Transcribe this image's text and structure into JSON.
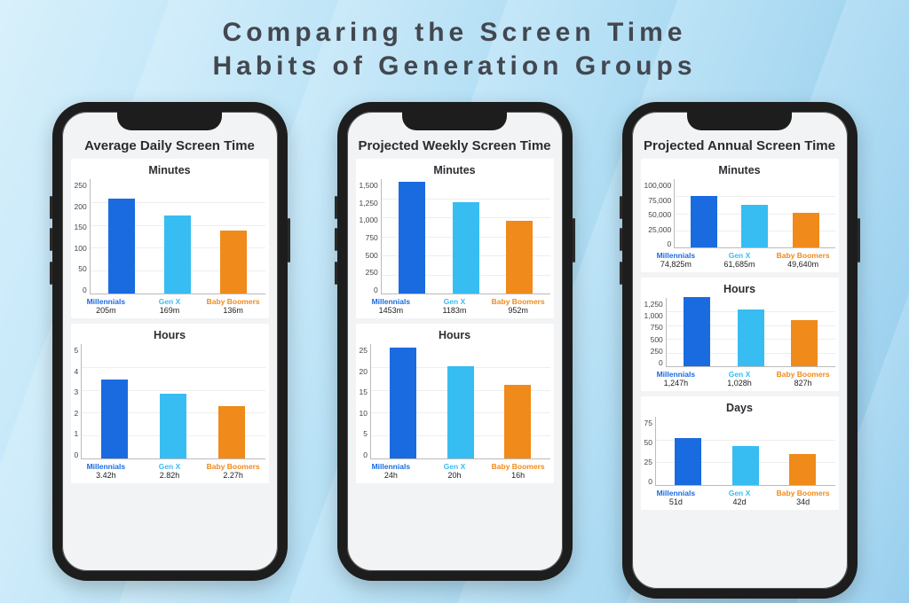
{
  "title_line1": "Comparing the Screen Time",
  "title_line2": "Habits of Generation Groups",
  "categories": [
    "Millennials",
    "Gen X",
    "Baby Boomers"
  ],
  "colors": [
    "#1a6be0",
    "#37bdf2",
    "#f08a1a"
  ],
  "phones": [
    {
      "title": "Average Daily Screen Time",
      "charts": [
        {
          "title": "Minutes",
          "unit": "m",
          "ymax": 250,
          "ticks": [
            "250",
            "200",
            "150",
            "100",
            "50",
            "0"
          ],
          "values": [
            205,
            169,
            136
          ],
          "labels": [
            "205m",
            "169m",
            "136m"
          ]
        },
        {
          "title": "Hours",
          "unit": "h",
          "ymax": 5,
          "ticks": [
            "5",
            "4",
            "3",
            "2",
            "1",
            "0"
          ],
          "values": [
            3.42,
            2.82,
            2.27
          ],
          "labels": [
            "3.42h",
            "2.82h",
            "2.27h"
          ]
        }
      ]
    },
    {
      "title": "Projected Weekly Screen Time",
      "charts": [
        {
          "title": "Minutes",
          "unit": "m",
          "ymax": 1500,
          "ticks": [
            "1,500",
            "1,250",
            "1,000",
            "750",
            "500",
            "250",
            "0"
          ],
          "values": [
            1453,
            1183,
            952
          ],
          "labels": [
            "1453m",
            "1183m",
            "952m"
          ]
        },
        {
          "title": "Hours",
          "unit": "h",
          "ymax": 25,
          "ticks": [
            "25",
            "20",
            "15",
            "10",
            "5",
            "0"
          ],
          "values": [
            24,
            20,
            16
          ],
          "labels": [
            "24h",
            "20h",
            "16h"
          ]
        }
      ]
    },
    {
      "title": "Projected Annual Screen Time",
      "tall": true,
      "charts": [
        {
          "title": "Minutes",
          "unit": "m",
          "ymax": 100000,
          "ticks": [
            "100,000",
            "75,000",
            "50,000",
            "25,000",
            "0"
          ],
          "values": [
            74825,
            61685,
            49640
          ],
          "labels": [
            "74,825m",
            "61,685m",
            "49,640m"
          ]
        },
        {
          "title": "Hours",
          "unit": "h",
          "ymax": 1250,
          "ticks": [
            "1,250",
            "1,000",
            "750",
            "500",
            "250",
            "0"
          ],
          "values": [
            1247,
            1028,
            827
          ],
          "labels": [
            "1,247h",
            "1,028h",
            "827h"
          ]
        },
        {
          "title": "Days",
          "unit": "d",
          "ymax": 75,
          "ticks": [
            "75",
            "50",
            "25",
            "0"
          ],
          "values": [
            51,
            42,
            34
          ],
          "labels": [
            "51d",
            "42d",
            "34d"
          ]
        }
      ]
    }
  ],
  "chart_data": [
    {
      "type": "bar",
      "title": "Average Daily Screen Time — Minutes",
      "categories": [
        "Millennials",
        "Gen X",
        "Baby Boomers"
      ],
      "values": [
        205,
        169,
        136
      ],
      "ylabel": "Minutes",
      "xlabel": "",
      "ylim": [
        0,
        250
      ]
    },
    {
      "type": "bar",
      "title": "Average Daily Screen Time — Hours",
      "categories": [
        "Millennials",
        "Gen X",
        "Baby Boomers"
      ],
      "values": [
        3.42,
        2.82,
        2.27
      ],
      "ylabel": "Hours",
      "xlabel": "",
      "ylim": [
        0,
        5
      ]
    },
    {
      "type": "bar",
      "title": "Projected Weekly Screen Time — Minutes",
      "categories": [
        "Millennials",
        "Gen X",
        "Baby Boomers"
      ],
      "values": [
        1453,
        1183,
        952
      ],
      "ylabel": "Minutes",
      "xlabel": "",
      "ylim": [
        0,
        1500
      ]
    },
    {
      "type": "bar",
      "title": "Projected Weekly Screen Time — Hours",
      "categories": [
        "Millennials",
        "Gen X",
        "Baby Boomers"
      ],
      "values": [
        24,
        20,
        16
      ],
      "ylabel": "Hours",
      "xlabel": "",
      "ylim": [
        0,
        25
      ]
    },
    {
      "type": "bar",
      "title": "Projected Annual Screen Time — Minutes",
      "categories": [
        "Millennials",
        "Gen X",
        "Baby Boomers"
      ],
      "values": [
        74825,
        61685,
        49640
      ],
      "ylabel": "Minutes",
      "xlabel": "",
      "ylim": [
        0,
        100000
      ]
    },
    {
      "type": "bar",
      "title": "Projected Annual Screen Time — Hours",
      "categories": [
        "Millennials",
        "Gen X",
        "Baby Boomers"
      ],
      "values": [
        1247,
        1028,
        827
      ],
      "ylabel": "Hours",
      "xlabel": "",
      "ylim": [
        0,
        1250
      ]
    },
    {
      "type": "bar",
      "title": "Projected Annual Screen Time — Days",
      "categories": [
        "Millennials",
        "Gen X",
        "Baby Boomers"
      ],
      "values": [
        51,
        42,
        34
      ],
      "ylabel": "Days",
      "xlabel": "",
      "ylim": [
        0,
        75
      ]
    }
  ]
}
